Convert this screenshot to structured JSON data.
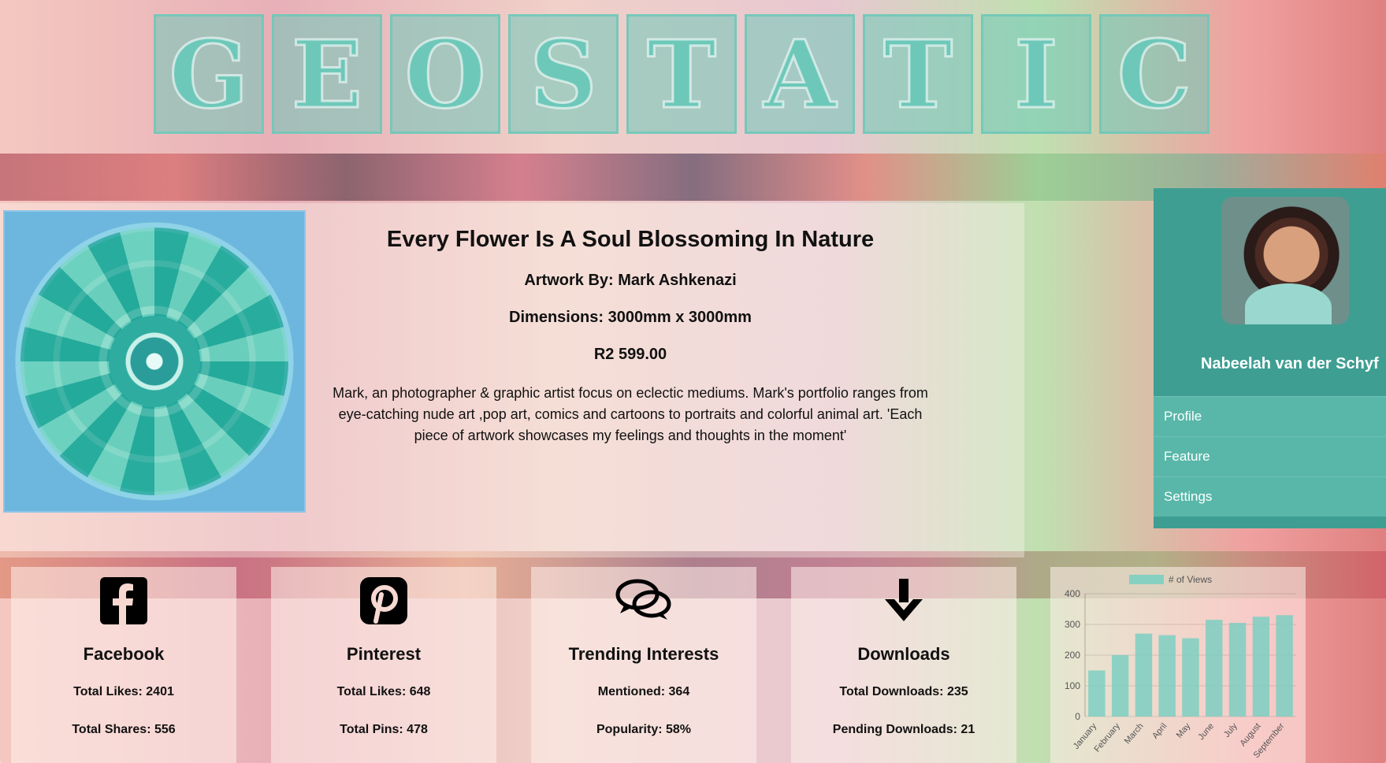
{
  "logo": {
    "letters": [
      "G",
      "E",
      "O",
      "S",
      "T",
      "A",
      "T",
      "I",
      "C"
    ]
  },
  "artwork": {
    "title": "Every Flower Is A Soul Blossoming In Nature",
    "artist": "Artwork By: Mark Ashkenazi",
    "dimensions": "Dimensions: 3000mm x 3000mm",
    "price": "R2 599.00",
    "description": "Mark, an photographer & graphic artist focus on eclectic mediums. Mark's portfolio ranges from eye-catching nude art ,pop art, comics and cartoons to portraits and colorful animal art. 'Each piece of artwork showcases my feelings and thoughts in the moment'"
  },
  "sidebar": {
    "user_name": "Nabeelah van der Schyf",
    "menu": [
      {
        "label": "Profile"
      },
      {
        "label": "Feature"
      },
      {
        "label": "Settings"
      }
    ]
  },
  "stats": [
    {
      "icon": "facebook-icon",
      "title": "Facebook",
      "line1": "Total Likes: 2401",
      "line2": "Total Shares: 556"
    },
    {
      "icon": "pinterest-icon",
      "title": "Pinterest",
      "line1": "Total Likes: 648",
      "line2": "Total Pins: 478"
    },
    {
      "icon": "speech-bubbles-icon",
      "title": "Trending Interests",
      "line1": "Mentioned: 364",
      "line2": "Popularity: 58%"
    },
    {
      "icon": "arrow-down-icon",
      "title": "Downloads",
      "line1": "Total Downloads: 235",
      "line2": "Pending Downloads: 21"
    }
  ],
  "chart_data": {
    "type": "bar",
    "categories": [
      "January",
      "February",
      "March",
      "April",
      "May",
      "June",
      "July",
      "August",
      "September"
    ],
    "series": [
      {
        "name": "# of Views",
        "values": [
          150,
          200,
          270,
          265,
          255,
          315,
          305,
          325,
          330
        ]
      }
    ],
    "ylim": [
      0,
      400
    ],
    "yticks": [
      0,
      100,
      200,
      300,
      400
    ],
    "legend": "top",
    "color": "#7ccfc2",
    "grid": true
  }
}
